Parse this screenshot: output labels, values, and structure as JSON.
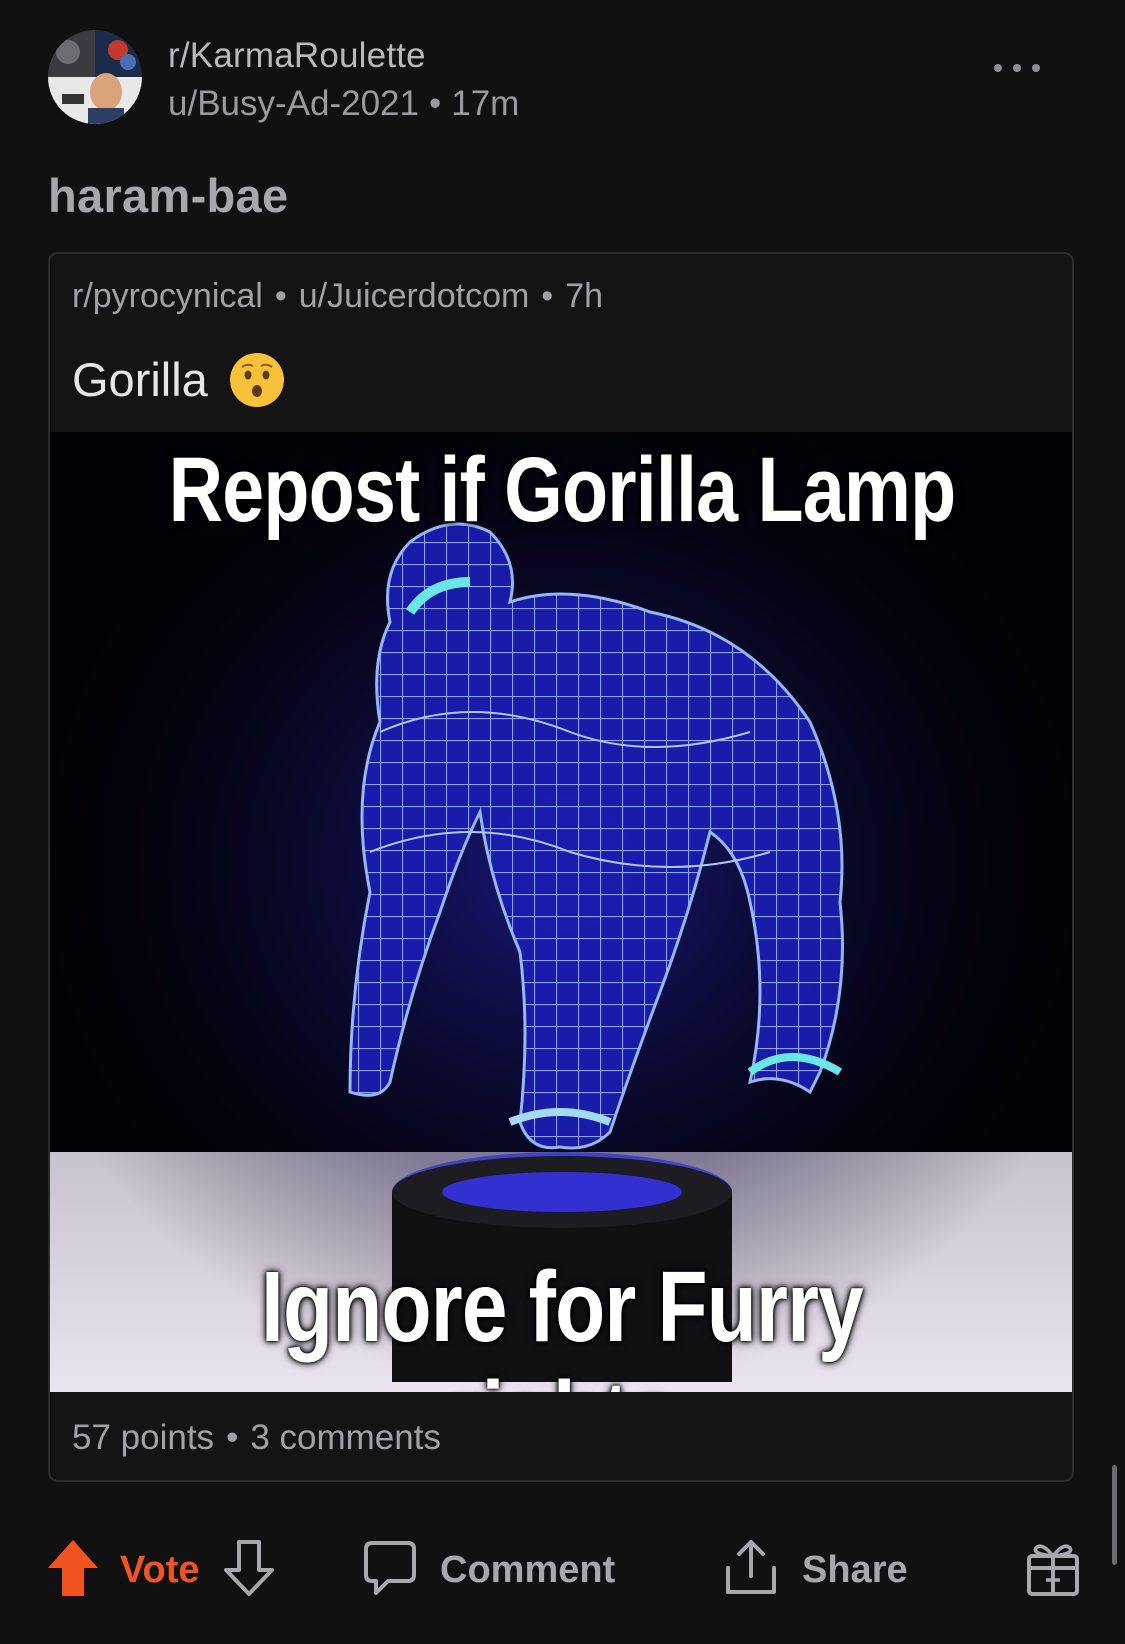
{
  "post": {
    "subreddit": "r/KarmaRoulette",
    "author": "u/Busy-Ad-2021",
    "age": "17m",
    "title": "haram-bae",
    "meta_separator": "•"
  },
  "crosspost": {
    "subreddit": "r/pyrocynical",
    "author": "u/Juicerdotcom",
    "age": "7h",
    "title": "Gorilla",
    "title_emoji": "hushed-face-emoji",
    "image": {
      "caption_top": "Repost if Gorilla Lamp",
      "caption_bottom": "Ignore for Furry rights"
    },
    "points": "57 points",
    "comments": "3 comments"
  },
  "actions": {
    "vote_label": "Vote",
    "comment_label": "Comment",
    "share_label": "Share"
  },
  "icons": {
    "more": "more-horizontal-icon",
    "upvote": "upvote-arrow-icon",
    "downvote": "downvote-arrow-icon",
    "comment": "comment-bubble-icon",
    "share": "share-icon",
    "award": "gift-award-icon"
  },
  "colors": {
    "background": "#111112",
    "upvote_accent": "#f25421",
    "muted_text": "#a1a1a6",
    "card_border": "#2b2b2e"
  }
}
